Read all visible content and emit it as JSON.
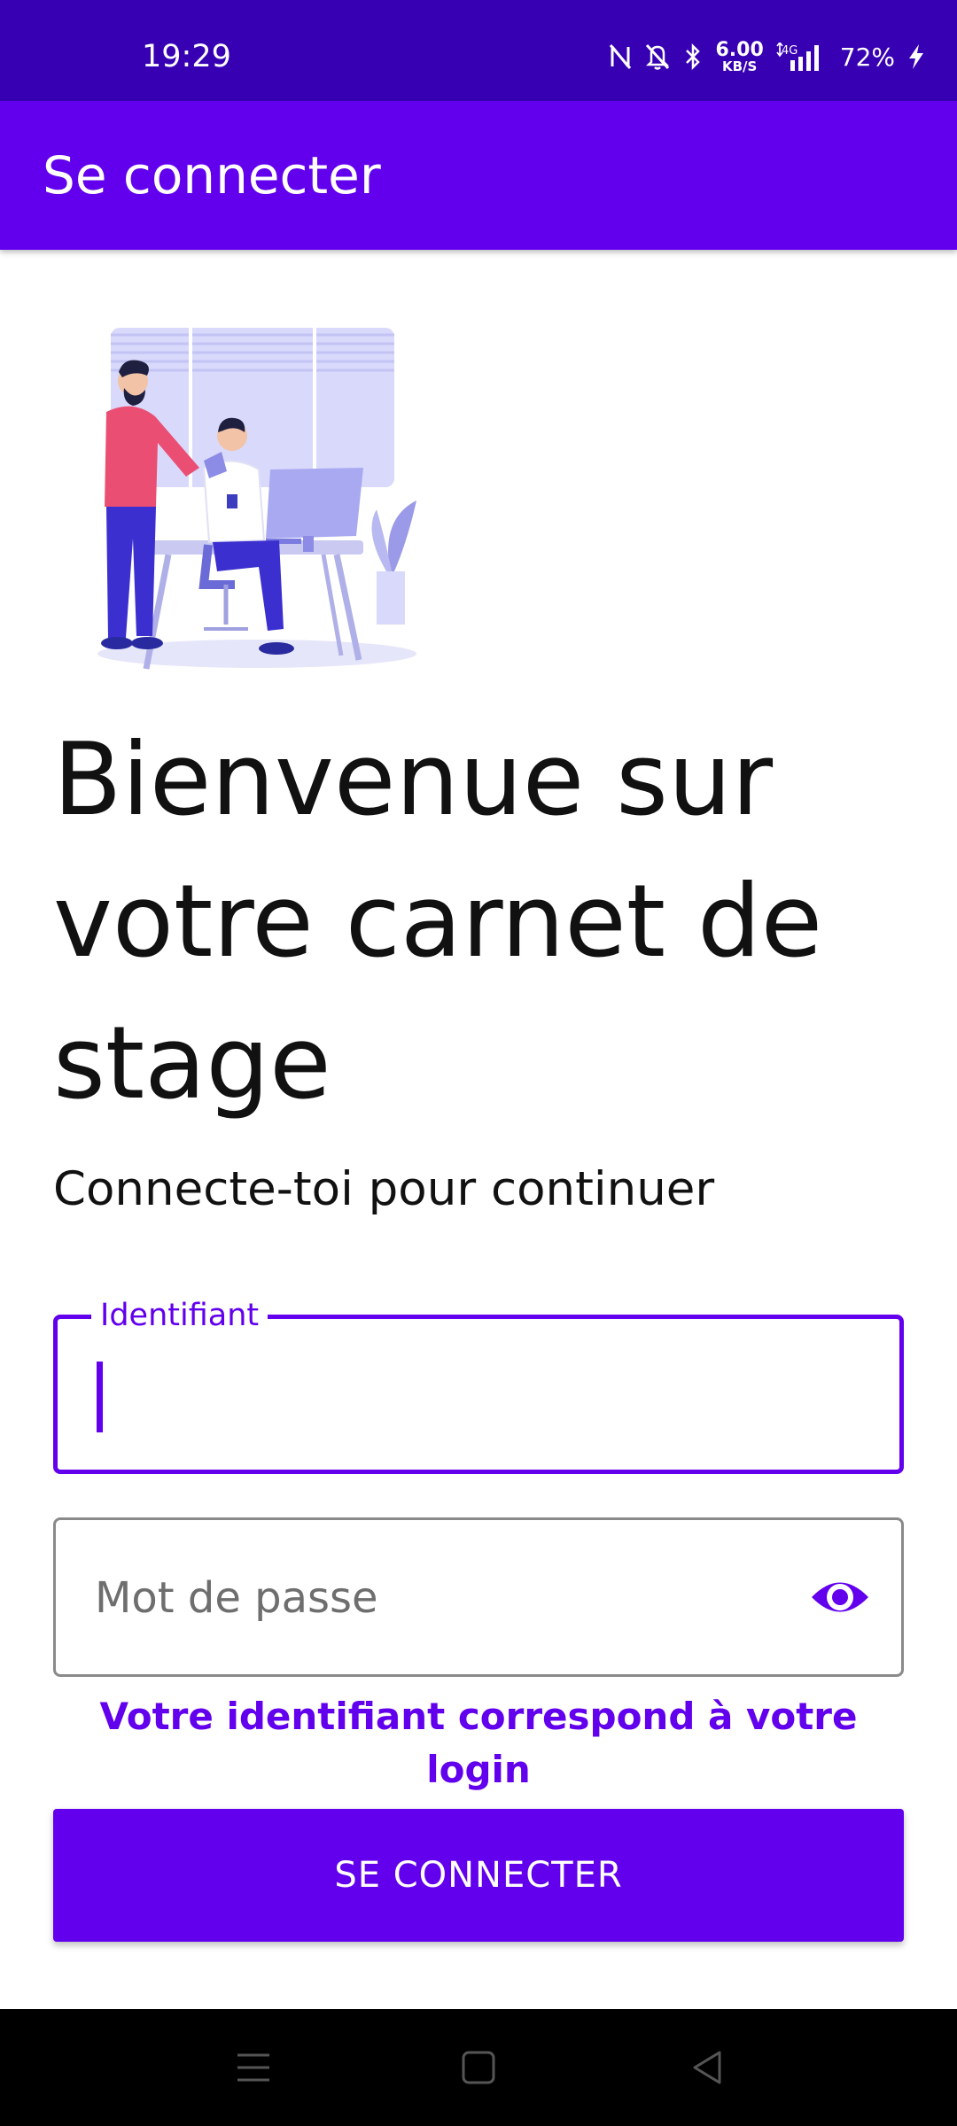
{
  "status_bar": {
    "time": "19:29",
    "speed_value": "6.00",
    "speed_unit": "KB/S",
    "network": "4G",
    "battery": "72%"
  },
  "app_bar": {
    "title": "Se connecter"
  },
  "welcome": {
    "title": "Bienvenue sur votre carnet de stage",
    "subtitle": "Connecte-toi pour continuer"
  },
  "form": {
    "identifier_label": "Identifiant",
    "identifier_value": "",
    "password_placeholder": "Mot de passe",
    "hint": "Votre identifiant correspond à votre login",
    "submit_label": "SE CONNECTER"
  },
  "colors": {
    "primary": "#6200ee",
    "primary_dark": "#3700b3"
  }
}
